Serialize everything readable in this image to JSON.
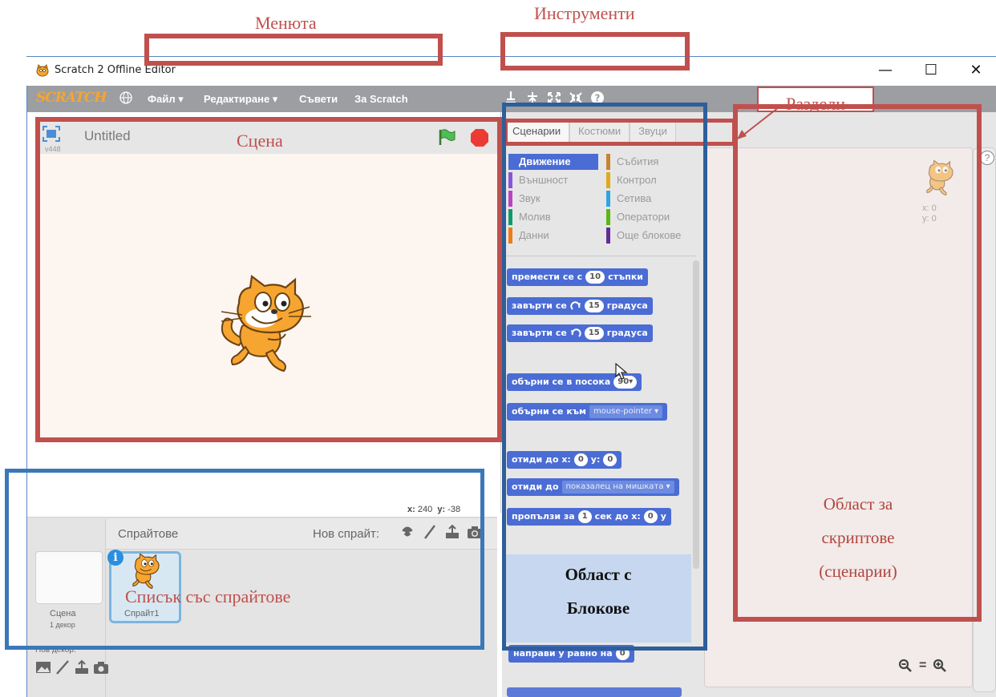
{
  "window": {
    "title": "Scratch 2 Offline Editor",
    "minimize": "—",
    "maximize": "☐",
    "close": "✕"
  },
  "menubar": {
    "logo": "SCRATCH",
    "items": [
      "Файл ▾",
      "Редактиране ▾",
      "Съвети",
      "За Scratch"
    ]
  },
  "stage": {
    "title": "Untitled",
    "version": "v448",
    "mouse_x_label": "x:",
    "mouse_x": "240",
    "mouse_y_label": "y:",
    "mouse_y": "-38"
  },
  "sprites": {
    "header": "Спрайтове",
    "new_sprite": "Нов спрайт:",
    "scene_label": "Сцена",
    "scene_sub": "1 декор",
    "new_decor": "Нов декор:",
    "sprite_name": "Спрайт1",
    "info": "i"
  },
  "tabs": [
    "Сценарии",
    "Костюми",
    "Звуци"
  ],
  "categories": [
    {
      "label": "Движение",
      "color": "#4a6cd4",
      "selected": true
    },
    {
      "label": "Събития",
      "color": "#c88330"
    },
    {
      "label": "Външност",
      "color": "#8a55d7"
    },
    {
      "label": "Контрол",
      "color": "#e1a91a"
    },
    {
      "label": "Звук",
      "color": "#bb42c3"
    },
    {
      "label": "Сетива",
      "color": "#2ca5e2"
    },
    {
      "label": "Молив",
      "color": "#0e9a6c"
    },
    {
      "label": "Оператори",
      "color": "#5cb712"
    },
    {
      "label": "Данни",
      "color": "#ee7d16"
    },
    {
      "label": "Още блокове",
      "color": "#632d99"
    }
  ],
  "blocks": {
    "move_a": "премести се с",
    "move_n": "10",
    "move_b": "стъпки",
    "turn_right_a": "завърти се",
    "turn_right_n": "15",
    "turn_right_b": "градуса",
    "turn_left_a": "завърти се",
    "turn_left_n": "15",
    "turn_left_b": "градуса",
    "point_dir_a": "обърни се в посока",
    "point_dir_n": "90▾",
    "point_towards_a": "обърни се към",
    "point_towards_v": "mouse-pointer ▾",
    "goto_xy_a": "отиди до x:",
    "goto_xy_x": "0",
    "goto_xy_b": "y:",
    "goto_xy_y": "0",
    "goto_a": "отиди до",
    "goto_v": "показалец на мишката ▾",
    "glide_a": "пропълзи за",
    "glide_n": "1",
    "glide_b": "сек до x:",
    "glide_x": "0",
    "glide_c": "у",
    "set_var_a": "направи у равно на",
    "set_var_n": "0"
  },
  "scripts_area": {
    "sprite_x": "x: 0",
    "sprite_y": "y: 0",
    "help": "?",
    "zoom_out": "🔍︎",
    "zoom_reset": "=",
    "zoom_in": "🔍︎"
  },
  "annotations": {
    "menus": "Менюта",
    "tools": "Инструменти",
    "sections": "Раздели",
    "stage": "Сцена",
    "sprite_list": "Списък със спрайтове",
    "blocks_area_1": "Област с",
    "blocks_area_2": "Блокове",
    "scripts_area_1": "Област за",
    "scripts_area_2": "скриптове",
    "scripts_area_3": "(сценарии)"
  },
  "colors": {
    "annotation_red": "#c0504d",
    "annotation_blue": "#2e5f99",
    "motion_block": "#4a6cd4",
    "menubar": "#9c9ea2",
    "logo": "#f7a531"
  }
}
